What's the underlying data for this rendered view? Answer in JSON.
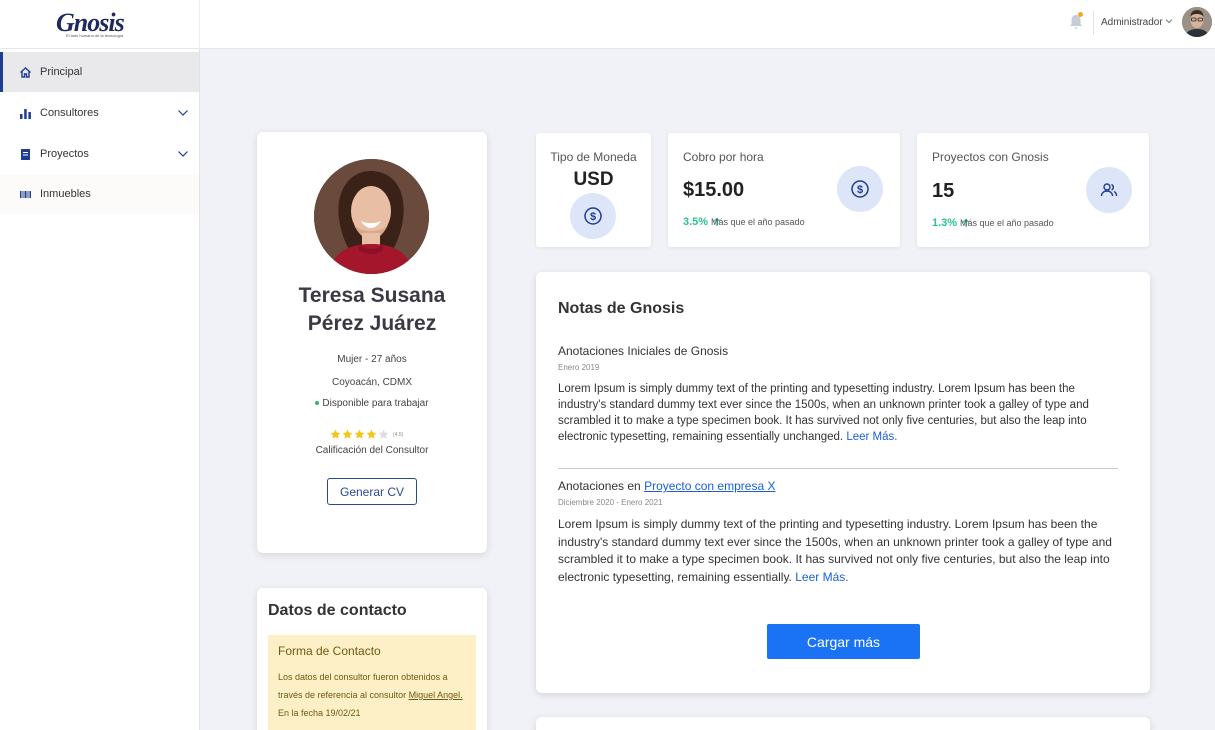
{
  "header": {
    "logo_text": "Gnosis",
    "logo_tagline": "El lado humano de la tecnología",
    "user_name": "Administrador",
    "icons": {
      "notifications": "bell-icon",
      "user_menu": "chevron-down-icon"
    }
  },
  "sidebar": {
    "items": [
      {
        "label": "Principal",
        "icon": "home-icon",
        "active": true
      },
      {
        "label": "Consultores",
        "icon": "bar-chart-icon",
        "expandable": true
      },
      {
        "label": "Proyectos",
        "icon": "document-icon",
        "expandable": true
      },
      {
        "label": "Inmuebles",
        "icon": "barcode-icon"
      }
    ]
  },
  "profile": {
    "name_line1": "Teresa Susana",
    "name_line2": "Pérez Juárez",
    "gender_age": "Mujer - 27 años",
    "location": "Coyoacán, CDMX",
    "availability": "Disponible para trabajar",
    "rating": 4.5,
    "rating_display": "(4.5)",
    "rating_label": "Calificación del Consultor",
    "cv_button": "Generar CV"
  },
  "contact": {
    "title": "Datos de contacto",
    "box_title": "Forma de Contacto",
    "text_before": "Los datos del consultor fueron obtenidos a través de referencia al consultor ",
    "referrer": "Miguel Angel.",
    "text_after": " En la fecha 19/02/21"
  },
  "stats": {
    "currency": {
      "label": "Tipo de Moneda",
      "value": "USD",
      "icon": "dollar-coin-icon"
    },
    "hourly": {
      "label": "Cobro por hora",
      "value": "$15.00",
      "trend": "3.5%",
      "trend_note": "Más que el año pasado",
      "icon": "dollar-coin-icon"
    },
    "projects": {
      "label": "Proyectos con Gnosis",
      "value": "15",
      "trend": "1.3%",
      "trend_note": "Más que el año pasado",
      "icon": "users-icon"
    }
  },
  "notes": {
    "title": "Notas de Gnosis",
    "items": [
      {
        "title": "Anotaciones Iniciales de Gnosis",
        "date": "Enero 2019",
        "body": "Lorem Ipsum is simply dummy text of the printing and typesetting industry. Lorem Ipsum has been the industry's standard dummy text ever since the 1500s, when an unknown printer took a galley of type and scrambled it to make a type specimen book. It has survived not only five centuries, but also the leap into electronic typesetting, remaining essentially unchanged. ",
        "read_more": "Leer Más."
      },
      {
        "title_prefix": "Anotaciones en ",
        "title_link": "Proyecto con empresa X",
        "date": "Diciembre 2020 - Enero 2021",
        "body": "Lorem Ipsum is simply dummy text of the printing and typesetting industry. Lorem Ipsum has been the industry's standard dummy text ever since the 1500s, when an unknown printer took a galley of type and scrambled it to make a type specimen book. It has survived not only five centuries, but also the leap into electronic typesetting, remaining essentially. ",
        "read_more": "Leer Más."
      }
    ],
    "load_more": "Cargar más"
  },
  "colors": {
    "accent": "#1a73f5",
    "nav_active": "#1f3d91",
    "trend_up": "#2bc58b",
    "contact_bg": "#fdf0c7"
  }
}
